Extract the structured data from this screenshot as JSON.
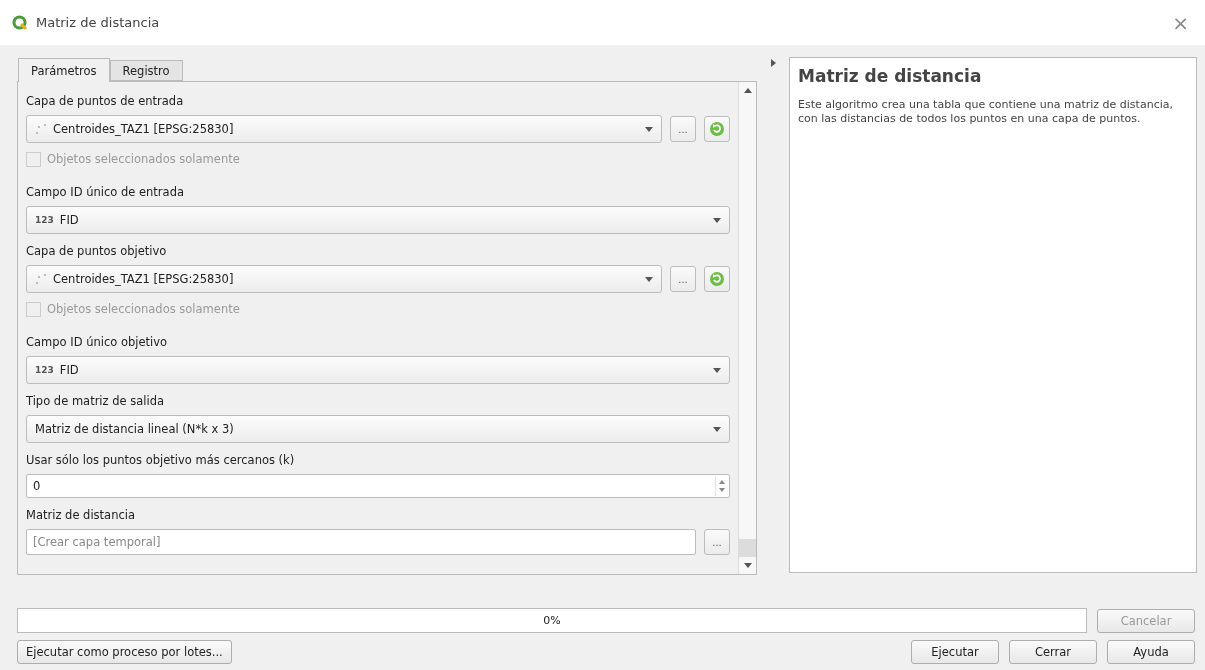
{
  "window": {
    "title": "Matriz de distancia",
    "close": "×"
  },
  "tabs": [
    {
      "label": "Parámetros",
      "selected": true
    },
    {
      "label": "Registro",
      "selected": false
    }
  ],
  "parameters": [
    {
      "kind": "label",
      "text": "Capa de puntos de entrada"
    },
    {
      "kind": "layer",
      "value": "Centroides_TAZ1 [EPSG:25830]",
      "browse": "..."
    },
    {
      "kind": "checkbox",
      "label": "Objetos seleccionados solamente",
      "checked": false,
      "disabled": true
    },
    {
      "kind": "label",
      "text": "Campo ID único de entrada"
    },
    {
      "kind": "field",
      "badge": "123",
      "value": "FID"
    },
    {
      "kind": "label",
      "text": "Capa de puntos objetivo"
    },
    {
      "kind": "layer",
      "value": "Centroides_TAZ1 [EPSG:25830]",
      "browse": "..."
    },
    {
      "kind": "checkbox",
      "label": "Objetos seleccionados solamente",
      "checked": false,
      "disabled": true
    },
    {
      "kind": "label",
      "text": "Campo ID único objetivo"
    },
    {
      "kind": "field",
      "badge": "123",
      "value": "FID"
    },
    {
      "kind": "label",
      "text": "Tipo de matriz de salida"
    },
    {
      "kind": "combo",
      "value": "Matriz de distancia lineal (N*k x 3)"
    },
    {
      "kind": "label",
      "text": "Usar sólo los puntos objetivo más cercanos (k)"
    },
    {
      "kind": "spin",
      "value": "0"
    },
    {
      "kind": "label",
      "text": "Matriz de distancia"
    },
    {
      "kind": "output",
      "placeholder": "[Crear capa temporal]",
      "browse": "..."
    }
  ],
  "help": {
    "title": "Matriz de distancia",
    "text": "Este algoritmo crea una tabla que contiene una matriz de distancia, con las distancias de todos los puntos en una capa de puntos."
  },
  "progress": {
    "level": 0,
    "reading": "0%"
  },
  "cancel_button": {
    "label": "Cancelar",
    "disabled": true
  },
  "batch_button": "Ejecutar como proceso por lotes...",
  "buttons": [
    "Ejecutar",
    "Cerrar",
    "Ayuda"
  ]
}
